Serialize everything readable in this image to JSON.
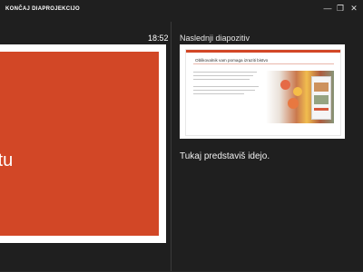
{
  "topbar": {
    "end_show_label": "KONČAJ DIAPROJEKCIJO",
    "window_controls": {
      "minimize_icon": "minimize-icon",
      "restore_icon": "restore-icon",
      "close_icon": "close-icon",
      "minimize_glyph": "—",
      "restore_glyph": "❐",
      "close_glyph": "✕"
    }
  },
  "presenter": {
    "time": "18:52",
    "current_slide_text": "intu",
    "next_slide_label": "Naslednji diapozitiv",
    "next_slide_title": "Oblikovalnik vam pomaga izraziti bistvo",
    "notes": "Tukaj predstaviš idejo."
  },
  "colors": {
    "background": "#1f1f1f",
    "slide_accent": "#d24726"
  }
}
